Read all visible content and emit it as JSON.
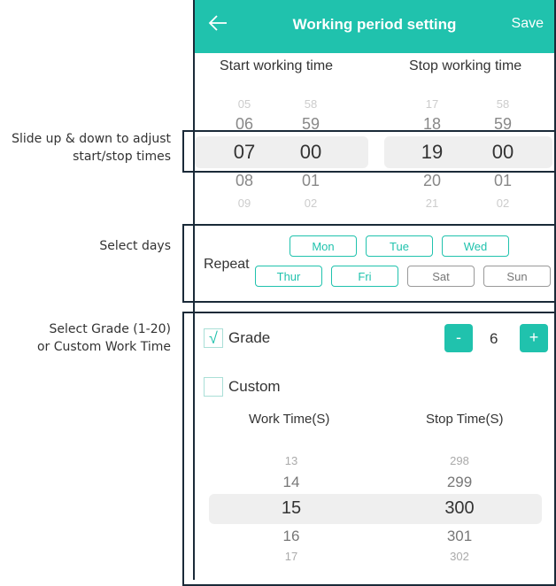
{
  "annotations": {
    "times": [
      "Slide up & down to adjust",
      "start/stop times"
    ],
    "days": "Select days",
    "grade": [
      "Select Grade (1-20)",
      "or Custom Work Time"
    ]
  },
  "header": {
    "back_icon": "arrow-left-icon",
    "title": "Working period setting",
    "save_label": "Save"
  },
  "time_picker": {
    "start_label": "Start working time",
    "stop_label": "Stop working time",
    "start_hours": [
      "05",
      "06",
      "07",
      "08",
      "09"
    ],
    "start_minutes": [
      "58",
      "59",
      "00",
      "01",
      "02"
    ],
    "stop_hours": [
      "17",
      "18",
      "19",
      "20",
      "21"
    ],
    "stop_minutes": [
      "58",
      "59",
      "00",
      "01",
      "02"
    ],
    "selected": {
      "start": "07:00",
      "stop": "19:00"
    }
  },
  "repeat": {
    "label": "Repeat",
    "days": [
      {
        "name": "Mon",
        "selected": true
      },
      {
        "name": "Tue",
        "selected": true
      },
      {
        "name": "Wed",
        "selected": true
      },
      {
        "name": "Thur",
        "selected": true
      },
      {
        "name": "Fri",
        "selected": true
      },
      {
        "name": "Sat",
        "selected": false
      },
      {
        "name": "Sun",
        "selected": false
      }
    ]
  },
  "grade": {
    "checked": true,
    "check_mark": "√",
    "label": "Grade",
    "value": "6",
    "minus": "-",
    "plus": "+"
  },
  "custom": {
    "checked": false,
    "label": "Custom",
    "work_label": "Work Time(S)",
    "stop_label": "Stop Time(S)",
    "work_values": [
      "13",
      "14",
      "15",
      "16",
      "17"
    ],
    "stop_values": [
      "298",
      "299",
      "300",
      "301",
      "302"
    ]
  },
  "colors": {
    "accent": "#20c2ad",
    "frame": "#1a2a38"
  }
}
